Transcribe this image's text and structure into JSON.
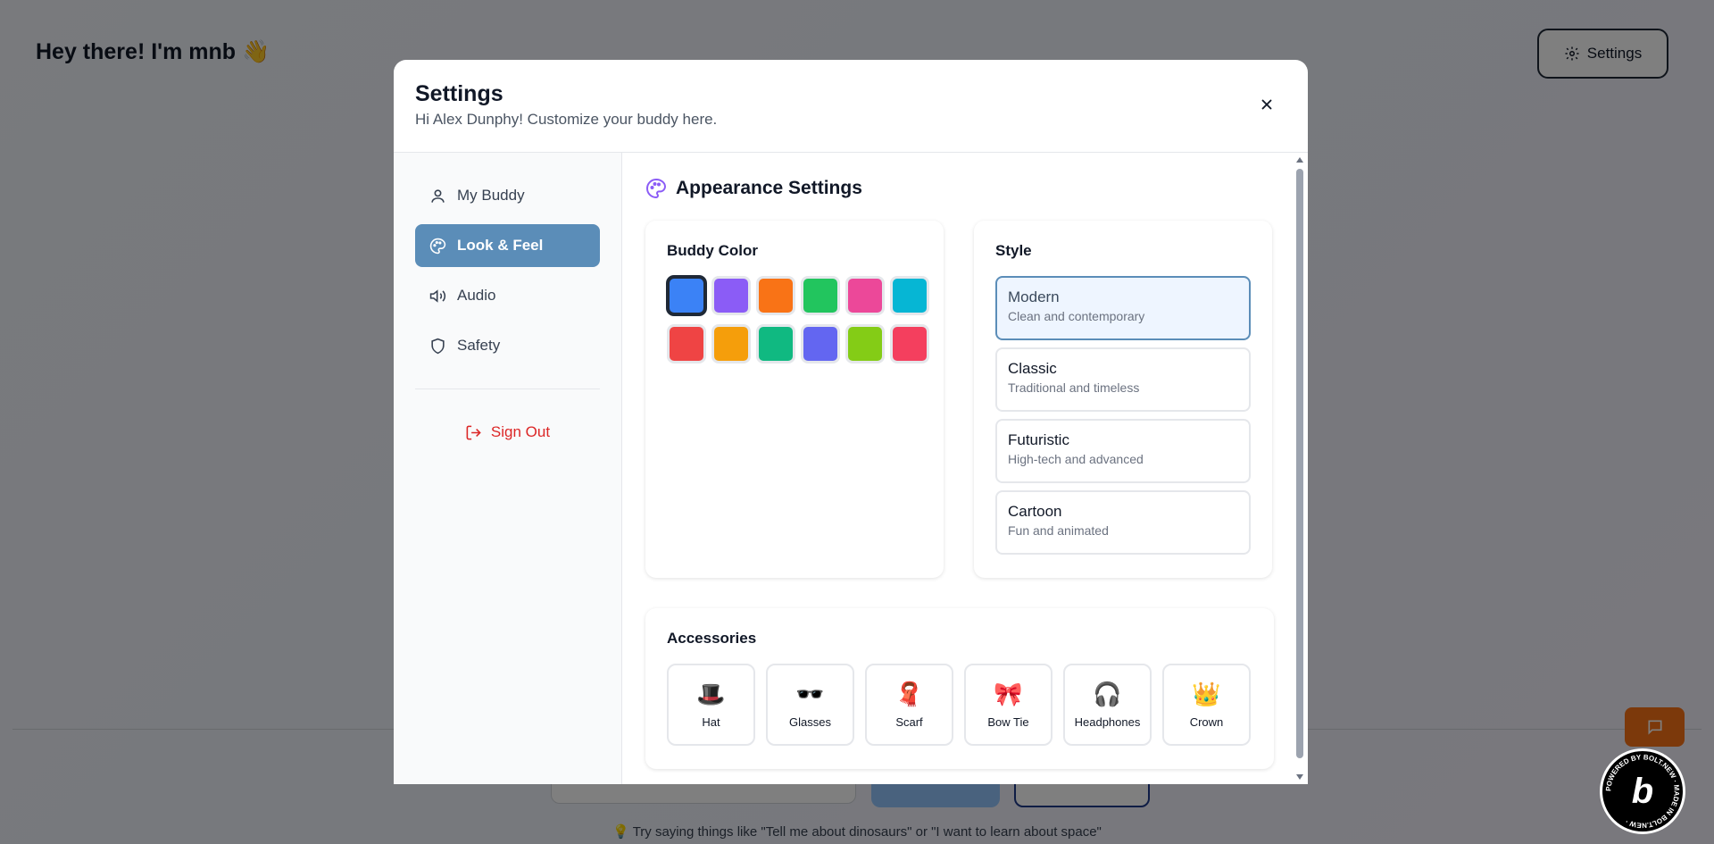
{
  "background": {
    "greeting": "Hey there! I'm mnb 👋",
    "settings_button": "Settings",
    "hint": "💡 Try saying things like \"Tell me about dinosaurs\" or \"I want to learn about space\""
  },
  "modal": {
    "title": "Settings",
    "subtitle": "Hi Alex Dunphy! Customize your buddy here."
  },
  "sidebar": {
    "items": [
      {
        "label": "My Buddy",
        "icon": "user-icon"
      },
      {
        "label": "Look & Feel",
        "icon": "palette-icon"
      },
      {
        "label": "Audio",
        "icon": "speaker-icon"
      },
      {
        "label": "Safety",
        "icon": "shield-icon"
      }
    ],
    "active_index": 1,
    "sign_out": "Sign Out"
  },
  "appearance": {
    "title": "Appearance Settings",
    "buddy_color": {
      "title": "Buddy Color",
      "colors": [
        "#3b82f6",
        "#8b5cf6",
        "#f97316",
        "#22c55e",
        "#ec4899",
        "#06b6d4",
        "#ef4444",
        "#f59e0b",
        "#10b981",
        "#6366f1",
        "#84cc16",
        "#f43f5e"
      ],
      "selected_index": 0
    },
    "style": {
      "title": "Style",
      "options": [
        {
          "name": "Modern",
          "desc": "Clean and contemporary"
        },
        {
          "name": "Classic",
          "desc": "Traditional and timeless"
        },
        {
          "name": "Futuristic",
          "desc": "High-tech and advanced"
        },
        {
          "name": "Cartoon",
          "desc": "Fun and animated"
        }
      ],
      "selected_index": 0
    },
    "accessories": {
      "title": "Accessories",
      "items": [
        {
          "emoji": "🎩",
          "label": "Hat"
        },
        {
          "emoji": "🕶️",
          "label": "Glasses"
        },
        {
          "emoji": "🧣",
          "label": "Scarf"
        },
        {
          "emoji": "🎀",
          "label": "Bow Tie"
        },
        {
          "emoji": "🎧",
          "label": "Headphones"
        },
        {
          "emoji": "👑",
          "label": "Crown"
        }
      ]
    }
  },
  "badge": {
    "letter": "b",
    "ring_text": "POWERED BY BOLT.NEW · MADE IN BOLT.NEW ·"
  }
}
